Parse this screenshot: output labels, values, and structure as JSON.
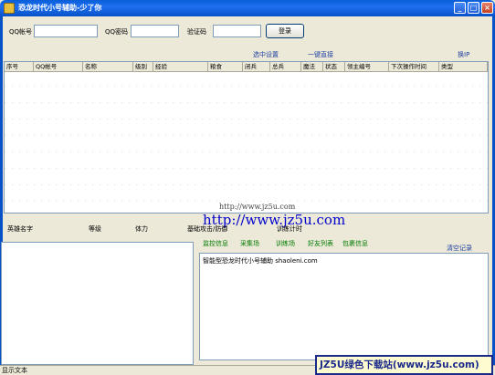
{
  "window": {
    "title": "恐龙时代小号辅助-少了你",
    "min": "_",
    "max": "□",
    "close": "×"
  },
  "login": {
    "account_label": "QQ帐号",
    "account_value": "",
    "password_label": "QQ密码",
    "password_value": "",
    "captcha_label": "验证码",
    "captcha_value": "",
    "submit": "登录"
  },
  "links": {
    "select_settings": "选中设置",
    "one_click_pull": "一键直接",
    "toggle": "换IP"
  },
  "table": {
    "columns": [
      "序号",
      "QQ帐号",
      "名称",
      "级别",
      "经验",
      "粮食",
      "闭兵",
      "总兵",
      "魔法",
      "状态",
      "领主编号",
      "下次操作时间",
      "类型"
    ]
  },
  "watermark": {
    "small": "http://www.jz5u.com",
    "large": "http://www.jz5u.com"
  },
  "hero_header": {
    "name": "英雄名字",
    "level": "等级",
    "stamina": "体力",
    "attack": "基础攻击/防御",
    "train": "训练计时"
  },
  "tabs": [
    "监控信息",
    "采集场",
    "训练场",
    "好友列表",
    "包裹信息"
  ],
  "log": {
    "clear": "清空记录",
    "text": "智能型恐龙时代小号辅助 shaoleni.com"
  },
  "status": {
    "text": "显示文本"
  },
  "badge": {
    "text": "JZ5U绿色下载站(www.jz5u.com)"
  }
}
